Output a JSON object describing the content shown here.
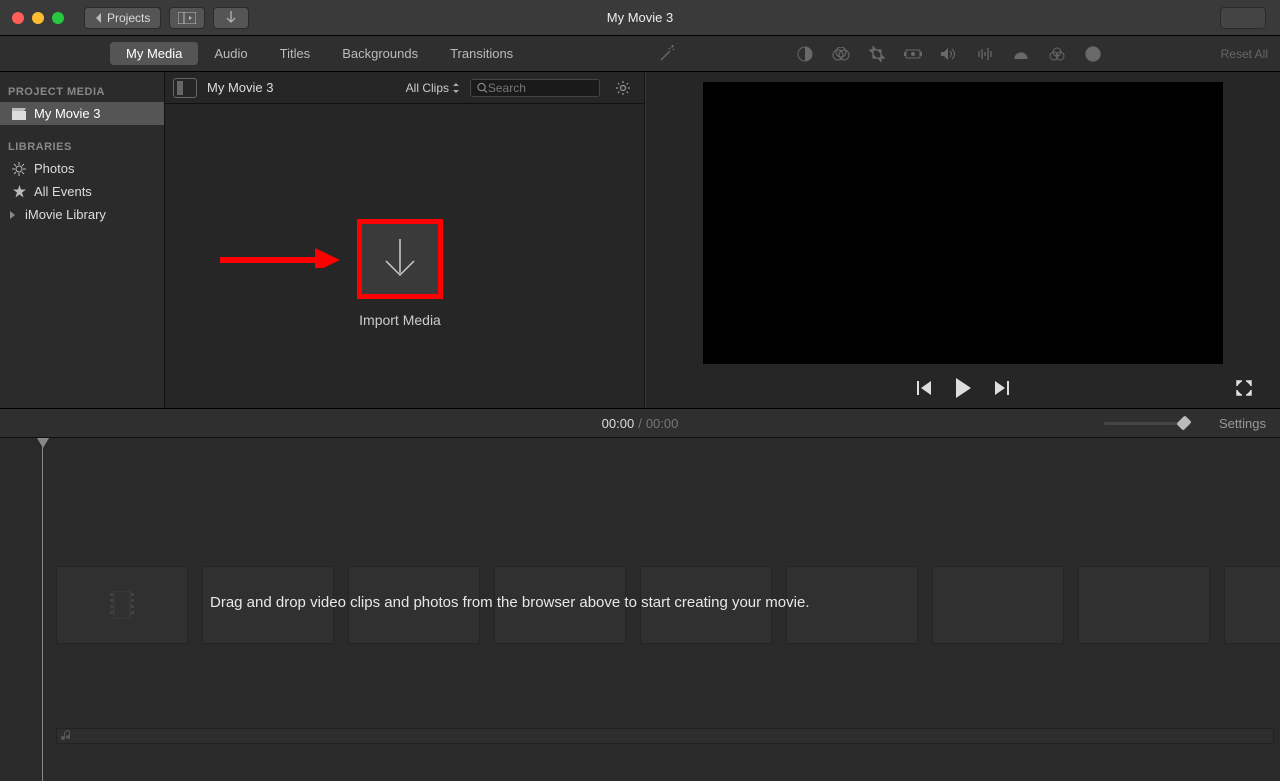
{
  "titlebar": {
    "projects_label": "Projects",
    "window_title": "My Movie 3"
  },
  "tabs": {
    "my_media": "My Media",
    "audio": "Audio",
    "titles": "Titles",
    "backgrounds": "Backgrounds",
    "transitions": "Transitions"
  },
  "viewer_toolbar": {
    "reset_all": "Reset All"
  },
  "sidebar": {
    "section_project": "PROJECT MEDIA",
    "project_item": "My Movie 3",
    "section_libraries": "LIBRARIES",
    "photos": "Photos",
    "all_events": "All Events",
    "imovie_library": "iMovie Library"
  },
  "browser": {
    "title": "My Movie 3",
    "all_clips": "All Clips",
    "search_placeholder": "Search",
    "import_label": "Import Media"
  },
  "timeline_header": {
    "current": "00:00",
    "total": "00:00",
    "settings": "Settings"
  },
  "timeline": {
    "hint": "Drag and drop video clips and photos from the browser above to start creating your movie."
  }
}
